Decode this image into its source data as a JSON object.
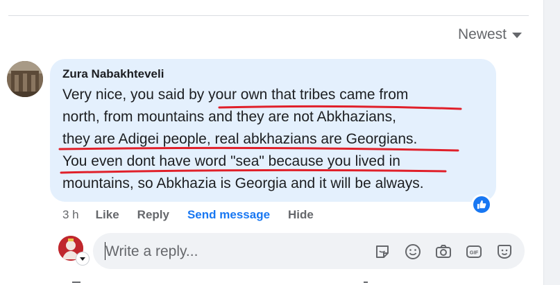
{
  "sort": {
    "label": "Newest"
  },
  "comment": {
    "author": "Zura Nabakhteveli",
    "lines": [
      "Very nice, you said by your own that tribes came from",
      "north, from mountains and they are not Abkhazians,",
      "they are Adigei people, real abkhazians are Georgians.",
      "You even dont have word \"sea\" because you lived in",
      "mountains, so Abkhazia is Georgia and it will be always."
    ],
    "annotation_color": "#e0202a",
    "bubble_color": "#e4f0fd"
  },
  "actions": {
    "time": "3 h",
    "like": "Like",
    "reply": "Reply",
    "send_message": "Send message",
    "hide": "Hide"
  },
  "reply": {
    "placeholder": "Write a reply...",
    "icons": [
      "sticker-icon",
      "emoji-icon",
      "camera-icon",
      "gif-icon",
      "avatar-sticker-icon"
    ]
  },
  "colors": {
    "accent": "#1877f2",
    "muted": "#65676b",
    "text": "#1c1e21"
  }
}
